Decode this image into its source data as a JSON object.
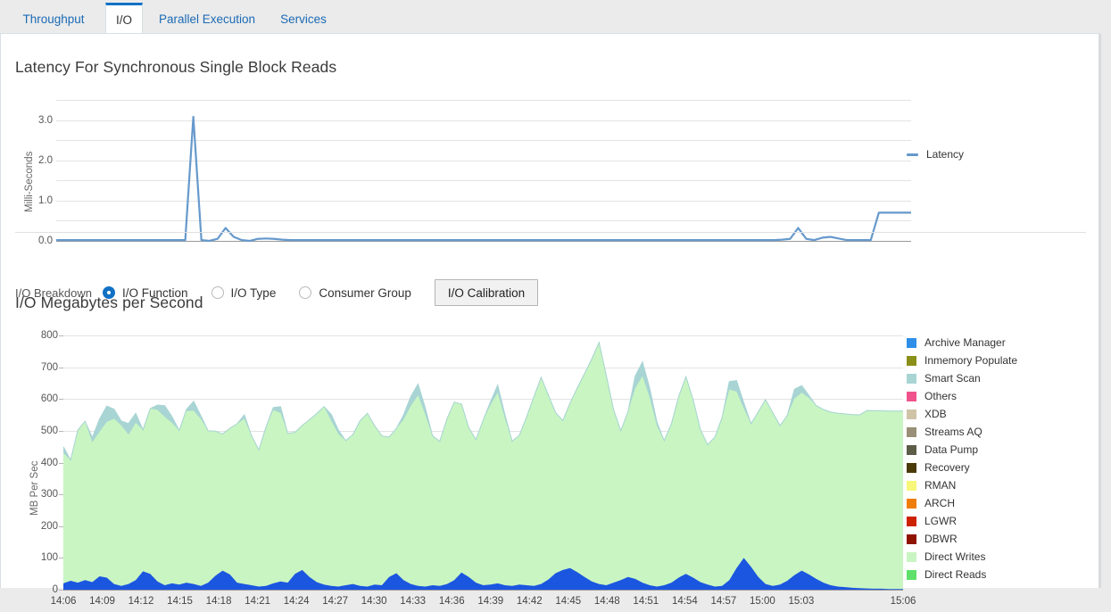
{
  "tabs": [
    {
      "label": "Throughput",
      "active": false
    },
    {
      "label": "I/O",
      "active": true
    },
    {
      "label": "Parallel Execution",
      "active": false
    },
    {
      "label": "Services",
      "active": false
    }
  ],
  "latency_section": {
    "title": "Latency For Synchronous Single Block Reads"
  },
  "controls": {
    "breakdown_label": "I/O Breakdown",
    "options": [
      {
        "label": "I/O Function",
        "selected": true
      },
      {
        "label": "I/O Type",
        "selected": false
      },
      {
        "label": "Consumer Group",
        "selected": false
      }
    ],
    "calibration_button": "I/O Calibration"
  },
  "mbps_section": {
    "title": "I/O Megabytes per Second"
  },
  "colors": {
    "accent": "#1271c4",
    "tab_link": "#1b6ab5",
    "latency_line": "#6699cc",
    "panel_bg": "#ffffff",
    "page_bg": "#ebebeb",
    "gridline": "#e3e3e3"
  },
  "chart_data": [
    {
      "type": "line",
      "title": "Latency For Synchronous Single Block Reads",
      "xlabel": "",
      "ylabel": "Milli-Seconds",
      "ylim": [
        0,
        3.5
      ],
      "yticks": [
        0.0,
        1.0,
        2.0,
        3.0
      ],
      "ytick_labels": [
        "0.0",
        "1.0",
        "2.0",
        "3.0"
      ],
      "grid": true,
      "legend_position": "right",
      "series": [
        {
          "name": "Latency",
          "color": "#6699cc",
          "values": [
            0.02,
            0.02,
            0.02,
            0.02,
            0.02,
            0.02,
            0.02,
            0.02,
            0.02,
            0.02,
            0.02,
            0.02,
            0.02,
            0.02,
            0.02,
            0.02,
            0.02,
            3.08,
            0.02,
            0.0,
            0.05,
            0.32,
            0.1,
            0.02,
            0.0,
            0.05,
            0.06,
            0.05,
            0.03,
            0.02,
            0.02,
            0.02,
            0.02,
            0.02,
            0.02,
            0.02,
            0.02,
            0.02,
            0.02,
            0.02,
            0.02,
            0.02,
            0.02,
            0.02,
            0.02,
            0.02,
            0.02,
            0.02,
            0.02,
            0.02,
            0.02,
            0.02,
            0.02,
            0.02,
            0.02,
            0.02,
            0.02,
            0.02,
            0.02,
            0.02,
            0.02,
            0.02,
            0.02,
            0.02,
            0.02,
            0.02,
            0.02,
            0.02,
            0.02,
            0.02,
            0.02,
            0.02,
            0.02,
            0.02,
            0.02,
            0.02,
            0.02,
            0.02,
            0.02,
            0.02,
            0.02,
            0.02,
            0.02,
            0.02,
            0.02,
            0.02,
            0.02,
            0.02,
            0.02,
            0.02,
            0.03,
            0.05,
            0.32,
            0.05,
            0.02,
            0.08,
            0.1,
            0.06,
            0.02,
            0.02,
            0.02,
            0.02,
            0.7,
            0.7,
            0.7,
            0.7,
            0.7
          ]
        }
      ]
    },
    {
      "type": "area",
      "stacked": true,
      "title": "I/O Megabytes per Second",
      "xlabel": "",
      "ylabel": "MB Per Sec",
      "ylim": [
        0,
        800
      ],
      "yticks": [
        0,
        100,
        200,
        300,
        400,
        500,
        600,
        700,
        800
      ],
      "ytick_labels": [
        "0",
        "100",
        "200",
        "300",
        "400",
        "500",
        "600",
        "700",
        "800"
      ],
      "grid": true,
      "legend_position": "right",
      "x_tick_labels": [
        "14:06",
        "14:09",
        "14:12",
        "14:15",
        "14:18",
        "14:21",
        "14:24",
        "14:27",
        "14:30",
        "14:33",
        "14:36",
        "14:39",
        "14:42",
        "14:45",
        "14:48",
        "14:51",
        "14:54",
        "14:57",
        "15:00",
        "15:03",
        "15:06"
      ],
      "legend_entries": [
        {
          "name": "Archive Manager",
          "color": "#2e8fe8"
        },
        {
          "name": "Inmemory Populate",
          "color": "#8a8f18"
        },
        {
          "name": "Smart Scan",
          "color": "#a8d4d4"
        },
        {
          "name": "Others",
          "color": "#f0528c"
        },
        {
          "name": "XDB",
          "color": "#cfc3a8"
        },
        {
          "name": "Streams AQ",
          "color": "#988f76"
        },
        {
          "name": "Data Pump",
          "color": "#5c5c47"
        },
        {
          "name": "Recovery",
          "color": "#4a3a08"
        },
        {
          "name": "RMAN",
          "color": "#f7f77a"
        },
        {
          "name": "ARCH",
          "color": "#ef7d0a"
        },
        {
          "name": "LGWR",
          "color": "#cc2200"
        },
        {
          "name": "DBWR",
          "color": "#8f1400"
        },
        {
          "name": "Direct Writes",
          "color": "#c9f5c2"
        },
        {
          "name": "Direct Reads",
          "color": "#5ee06a"
        }
      ],
      "series": [
        {
          "name": "Archive Manager",
          "color": "#1b56e0",
          "values": [
            20,
            28,
            22,
            30,
            24,
            42,
            38,
            18,
            12,
            18,
            30,
            58,
            50,
            26,
            14,
            20,
            16,
            22,
            18,
            12,
            22,
            44,
            60,
            48,
            22,
            18,
            14,
            10,
            12,
            20,
            26,
            22,
            50,
            62,
            40,
            24,
            16,
            12,
            10,
            14,
            18,
            12,
            10,
            16,
            14,
            40,
            52,
            30,
            18,
            12,
            10,
            14,
            12,
            18,
            30,
            54,
            40,
            22,
            14,
            16,
            20,
            14,
            12,
            16,
            14,
            12,
            18,
            32,
            52,
            62,
            68,
            55,
            40,
            26,
            18,
            14,
            22,
            30,
            40,
            34,
            22,
            14,
            10,
            14,
            22,
            38,
            50,
            38,
            24,
            16,
            10,
            12,
            30,
            68,
            100,
            72,
            40,
            18,
            12,
            16,
            28,
            46,
            60,
            48,
            34,
            22,
            14,
            10,
            8,
            6,
            5,
            4,
            3,
            3,
            2,
            2,
            2
          ]
        },
        {
          "name": "Direct Writes",
          "color": "#c9f5c2",
          "values": [
            410,
            380,
            480,
            500,
            440,
            455,
            490,
            520,
            505,
            470,
            495,
            445,
            520,
            540,
            530,
            505,
            485,
            540,
            545,
            525,
            478,
            455,
            430,
            460,
            500,
            520,
            470,
            430,
            500,
            545,
            530,
            470,
            445,
            455,
            495,
            530,
            560,
            520,
            480,
            455,
            470,
            520,
            545,
            500,
            470,
            440,
            455,
            505,
            560,
            600,
            540,
            470,
            455,
            520,
            560,
            530,
            470,
            450,
            520,
            565,
            600,
            525,
            455,
            470,
            530,
            595,
            650,
            580,
            505,
            470,
            520,
            580,
            640,
            700,
            760,
            660,
            545,
            470,
            520,
            600,
            650,
            590,
            505,
            455,
            500,
            570,
            620,
            560,
            480,
            440,
            470,
            530,
            600,
            555,
            470,
            450,
            520,
            580,
            545,
            500,
            520,
            555,
            560,
            555,
            545,
            545,
            545,
            545,
            545,
            545,
            545,
            560,
            560,
            560,
            560,
            560,
            560
          ]
        },
        {
          "name": "Smart Scan",
          "color": "#a8d4d4",
          "values": [
            20,
            0,
            0,
            0,
            15,
            40,
            50,
            30,
            14,
            35,
            30,
            0,
            0,
            15,
            35,
            20,
            0,
            5,
            30,
            10,
            0,
            0,
            0,
            0,
            0,
            12,
            0,
            0,
            0,
            8,
            20,
            0,
            0,
            0,
            0,
            0,
            0,
            20,
            12,
            0,
            0,
            0,
            0,
            0,
            0,
            0,
            0,
            15,
            30,
            35,
            22,
            0,
            0,
            0,
            0,
            0,
            0,
            0,
            0,
            10,
            24,
            12,
            0,
            0,
            0,
            0,
            0,
            0,
            0,
            0,
            0,
            0,
            0,
            0,
            0,
            0,
            0,
            0,
            0,
            38,
            45,
            30,
            12,
            0,
            0,
            0,
            0,
            0,
            0,
            0,
            0,
            0,
            25,
            35,
            18,
            0,
            0,
            0,
            0,
            0,
            0,
            30,
            22,
            8,
            0,
            0,
            0,
            0,
            0,
            0,
            0,
            0,
            0,
            0,
            0,
            0,
            0
          ]
        }
      ]
    }
  ]
}
